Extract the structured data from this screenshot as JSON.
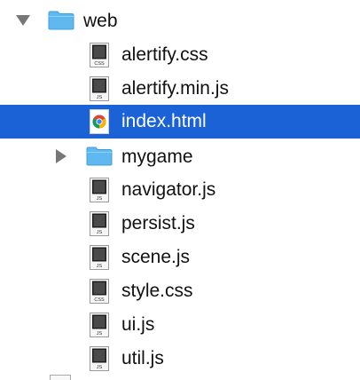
{
  "tree": {
    "web": {
      "label": "web",
      "expanded": true
    },
    "children": [
      {
        "label": "alertify.css",
        "type": "css",
        "icon": "css-file-icon",
        "badge": "CSS"
      },
      {
        "label": "alertify.min.js",
        "type": "js",
        "icon": "js-file-icon",
        "badge": "JS"
      },
      {
        "label": "index.html",
        "type": "html",
        "icon": "chrome-html-file-icon",
        "selected": true
      },
      {
        "label": "mygame",
        "type": "folder",
        "icon": "folder-icon",
        "expanded": false
      },
      {
        "label": "navigator.js",
        "type": "js",
        "icon": "js-file-icon",
        "badge": "JS"
      },
      {
        "label": "persist.js",
        "type": "js",
        "icon": "js-file-icon",
        "badge": "JS"
      },
      {
        "label": "scene.js",
        "type": "js",
        "icon": "js-file-icon",
        "badge": "JS"
      },
      {
        "label": "style.css",
        "type": "css",
        "icon": "css-file-icon",
        "badge": "CSS"
      },
      {
        "label": "ui.js",
        "type": "js",
        "icon": "js-file-icon",
        "badge": "JS"
      },
      {
        "label": "util.js",
        "type": "js",
        "icon": "js-file-icon",
        "badge": "JS"
      }
    ]
  },
  "colors": {
    "selection": "#1a62d6",
    "folder": "#5fb8f0",
    "text": "#111111"
  }
}
